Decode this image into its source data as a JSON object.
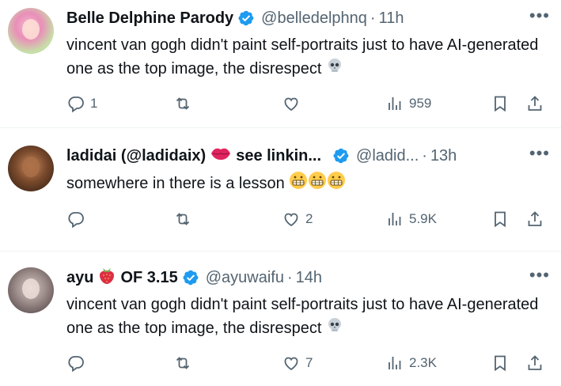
{
  "tweets": [
    {
      "name": "Belle Delphine Parody",
      "handle": "@belledelphnq",
      "time": "11h",
      "text": "vincent van gogh didn't paint self-portraits just to have AI-generated one as the top image, the disrespect",
      "text_emoji": "skull",
      "replies": "1",
      "retweets": "",
      "likes": "",
      "views": "959"
    },
    {
      "name": "ladidai (@ladidaix)",
      "name_emoji": "kiss-lips",
      "name_suffix": "see linkin...",
      "handle": "@ladid...",
      "time": "13h",
      "text": "somewhere in there is a lesson",
      "text_emoji": "grimacing x3",
      "replies": "",
      "retweets": "",
      "likes": "2",
      "views": "5.9K"
    },
    {
      "name": "ayu",
      "name_emoji": "strawberry",
      "name_suffix": "OF 3.15",
      "handle": "@ayuwaifu",
      "time": "14h",
      "text": "vincent van gogh didn't paint self-portraits just to have AI-generated one as the top image, the disrespect",
      "text_emoji": "skull",
      "replies": "",
      "retweets": "",
      "likes": "7",
      "views": "2.3K"
    }
  ],
  "colors": {
    "verified": "#1d9bf0",
    "secondary_text": "#536471",
    "text": "#0f1419",
    "divider": "#eff3f4"
  },
  "icons": [
    "reply-icon",
    "retweet-icon",
    "like-icon",
    "views-icon",
    "bookmark-icon",
    "share-icon",
    "verified-icon",
    "more-icon"
  ]
}
